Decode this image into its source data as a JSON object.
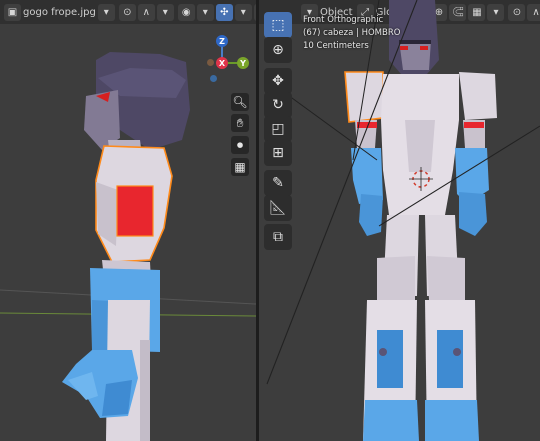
{
  "left_viewport": {
    "header": {
      "image_tab": "gogo frope.jpg"
    },
    "gizmo": {
      "z": "Z",
      "x": "X",
      "y": "Y"
    },
    "nav_buttons": [
      "zoom-icon",
      "hand-icon",
      "camera-icon",
      "grid-icon"
    ]
  },
  "right_viewport": {
    "header": {
      "object_menu": "Object",
      "global_menu": "Global"
    },
    "overlay": {
      "view_name": "Front Orthographic",
      "object_info": "(67) cabeza | HOMBRO",
      "grid_scale": "10 Centimeters"
    },
    "toolbar": [
      "select-box-icon",
      "cursor-icon",
      "move-icon",
      "rotate-icon",
      "scale-icon",
      "transform-icon",
      "annotate-icon",
      "measure-icon",
      "add-cube-icon"
    ]
  },
  "colors": {
    "viewport_bg": "#3d3d3d",
    "header_bg": "#303030",
    "active_blue": "#4772b3",
    "body_white": "#d9d4dc",
    "hair_purple": "#4e4865",
    "hand_blue": "#5aa7e8",
    "chest_red": "#e8262e",
    "selection_orange": "#ff8a1a"
  }
}
